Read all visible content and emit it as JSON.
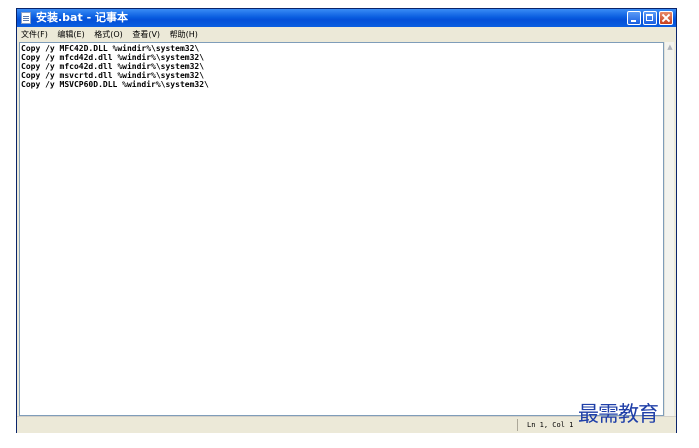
{
  "window": {
    "title": "安装.bat - 记事本"
  },
  "menu": {
    "items": [
      {
        "label": "文件(F)"
      },
      {
        "label": "编辑(E)"
      },
      {
        "label": "格式(O)"
      },
      {
        "label": "查看(V)"
      },
      {
        "label": "帮助(H)"
      }
    ]
  },
  "editor": {
    "lines": [
      "Copy /y MFC42D.DLL %windir%\\system32\\",
      "Copy /y mfcd42d.dll %windir%\\system32\\",
      "Copy /y mfco42d.dll %windir%\\system32\\",
      "Copy /y msvcrtd.dll %windir%\\system32\\",
      "Copy /y MSVCP60D.DLL %windir%\\system32\\"
    ]
  },
  "status": {
    "cursor_position": "Ln 1, Col 1"
  },
  "watermark": {
    "text": "最需教育"
  },
  "colors": {
    "titlebar": "#0a5ee0",
    "watermark": "#1f3fa8"
  }
}
